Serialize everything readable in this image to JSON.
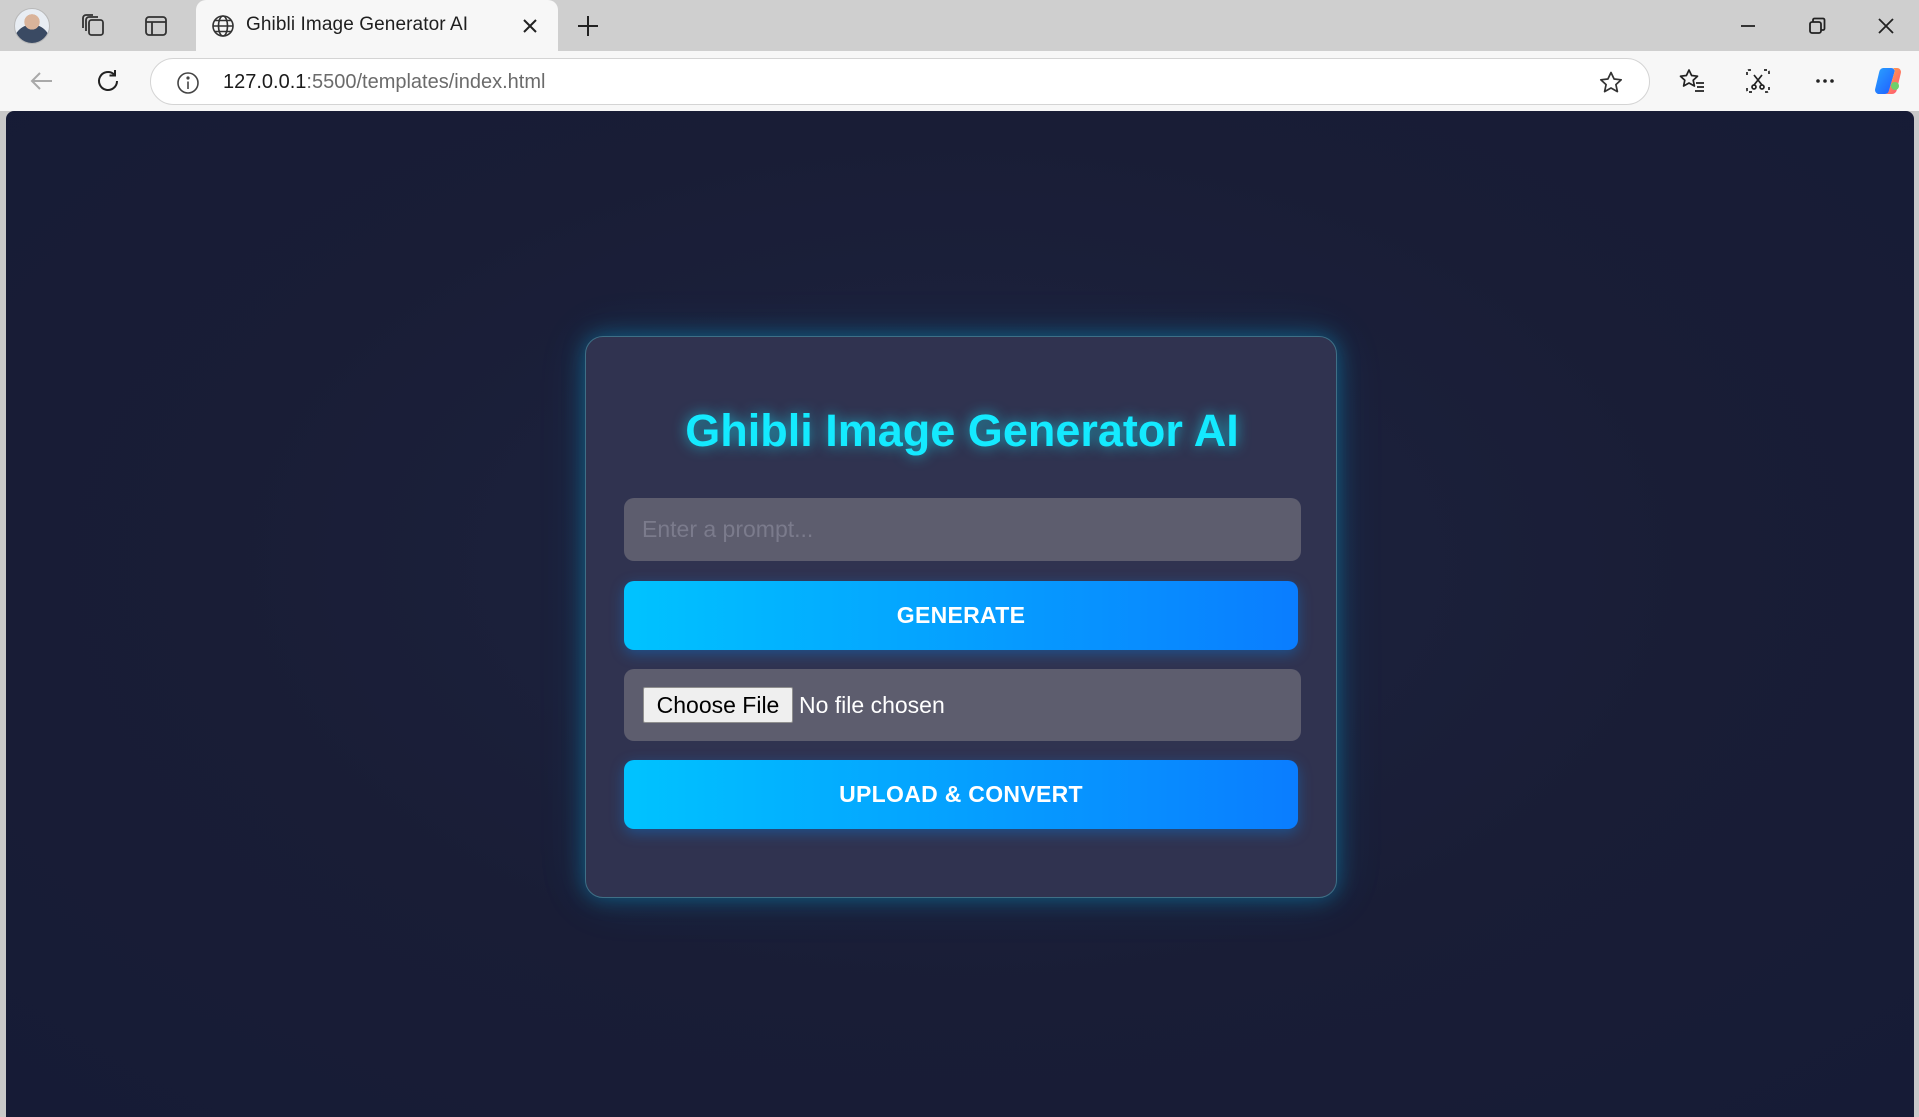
{
  "browser": {
    "tab_title": "Ghibli Image Generator AI",
    "url_host": "127.0.0.1",
    "url_rest": ":5500/templates/index.html"
  },
  "icons": {
    "tabstrip": [
      "profile-avatar",
      "workspaces-icon",
      "tab-actions-icon",
      "globe-icon",
      "close-icon",
      "plus-icon"
    ],
    "window": [
      "minimize-icon",
      "restore-icon",
      "close-icon"
    ],
    "toolbar": [
      "back-arrow-icon",
      "refresh-icon",
      "info-icon",
      "star-icon",
      "favorites-icon",
      "screenshot-icon",
      "more-icon",
      "copilot-icon"
    ]
  },
  "page": {
    "title": "Ghibli Image Generator AI",
    "prompt_placeholder": "Enter a prompt...",
    "generate_label": "GENERATE",
    "choose_file_label": "Choose File",
    "file_status": "No file chosen",
    "upload_label": "UPLOAD & CONVERT"
  },
  "colors": {
    "background": "#191d36",
    "card": "#303350",
    "title": "#14eaff",
    "button_gradient_start": "#00c3ff",
    "button_gradient_end": "#0a7dff",
    "input": "#5d5d6e"
  }
}
